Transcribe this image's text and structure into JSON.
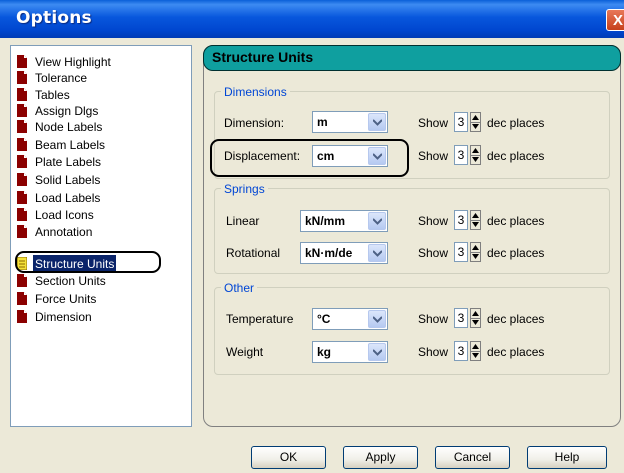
{
  "window": {
    "title": "Options",
    "close_glyph": "X"
  },
  "tree": {
    "items": [
      {
        "label": "View Highlight",
        "selected": false
      },
      {
        "label": "Tolerance",
        "selected": false
      },
      {
        "label": "Tables",
        "selected": false
      },
      {
        "label": "Assign Dlgs",
        "selected": false
      },
      {
        "label": "Node Labels",
        "selected": false
      },
      {
        "label": "Beam Labels",
        "selected": false
      },
      {
        "label": "Plate Labels",
        "selected": false
      },
      {
        "label": "Solid Labels",
        "selected": false
      },
      {
        "label": "Load Labels",
        "selected": false
      },
      {
        "label": "Load Icons",
        "selected": false
      },
      {
        "label": "Annotation",
        "selected": false
      },
      {
        "label": "Structure Units",
        "selected": true
      },
      {
        "label": "Section Units",
        "selected": false
      },
      {
        "label": "Force Units",
        "selected": false
      },
      {
        "label": "Dimension",
        "selected": false
      }
    ]
  },
  "panel": {
    "title": "Structure Units",
    "dimensions": {
      "title": "Dimensions",
      "dimension": {
        "label": "Dimension:",
        "unit": "m",
        "show": "Show",
        "decimals": "3",
        "suffix": "dec places"
      },
      "displacement": {
        "label": "Displacement:",
        "unit": "cm",
        "show": "Show",
        "decimals": "3",
        "suffix": "dec places"
      }
    },
    "springs": {
      "title": "Springs",
      "linear": {
        "label": "Linear",
        "unit": "kN/mm",
        "show": "Show",
        "decimals": "3",
        "suffix": "dec places"
      },
      "rotational": {
        "label": "Rotational",
        "unit": "kN·m/de",
        "show": "Show",
        "decimals": "3",
        "suffix": "dec places"
      }
    },
    "other": {
      "title": "Other",
      "temperature": {
        "label": "Temperature",
        "unit": "°C",
        "show": "Show",
        "decimals": "3",
        "suffix": "dec places"
      },
      "weight": {
        "label": "Weight",
        "unit": "kg",
        "show": "Show",
        "decimals": "3",
        "suffix": "dec places"
      }
    }
  },
  "buttons": {
    "ok": "OK",
    "apply": "Apply",
    "cancel": "Cancel",
    "help": "Help"
  },
  "colors": {
    "title_bar": "#0855dd",
    "panel_header": "#0f9f9f",
    "group_title": "#0046d5",
    "selection": "#0a246a"
  }
}
